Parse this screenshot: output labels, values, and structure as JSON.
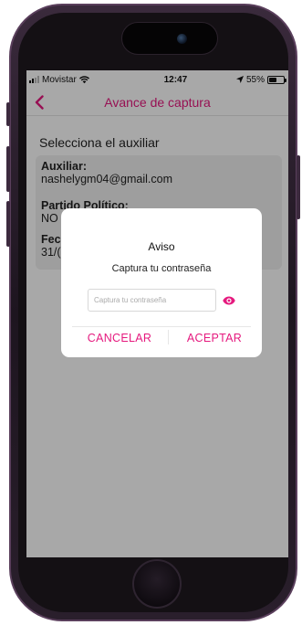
{
  "status_bar": {
    "carrier": "Movistar",
    "time": "12:47",
    "battery": "55%",
    "battery_level": 0.55
  },
  "nav": {
    "title": "Avance de captura",
    "back_icon": "chevron-left-icon"
  },
  "main": {
    "section_title": "Selecciona el auxiliar",
    "fields": [
      {
        "label": "Auxiliar:",
        "value": "nashelygm04@gmail.com"
      },
      {
        "label": "Partido Político:",
        "value": "NO"
      },
      {
        "label": "Fec",
        "value": "31/("
      }
    ]
  },
  "dialog": {
    "title": "Aviso",
    "message": "Captura tu contraseña",
    "password_placeholder": "Captura tu contraseña",
    "password_value": "",
    "cancel_label": "CANCELAR",
    "accept_label": "ACEPTAR"
  },
  "colors": {
    "accent": "#e5197e",
    "overlay": "rgba(0,0,0,0.34)",
    "phone_frame": "#3a2a3c"
  }
}
